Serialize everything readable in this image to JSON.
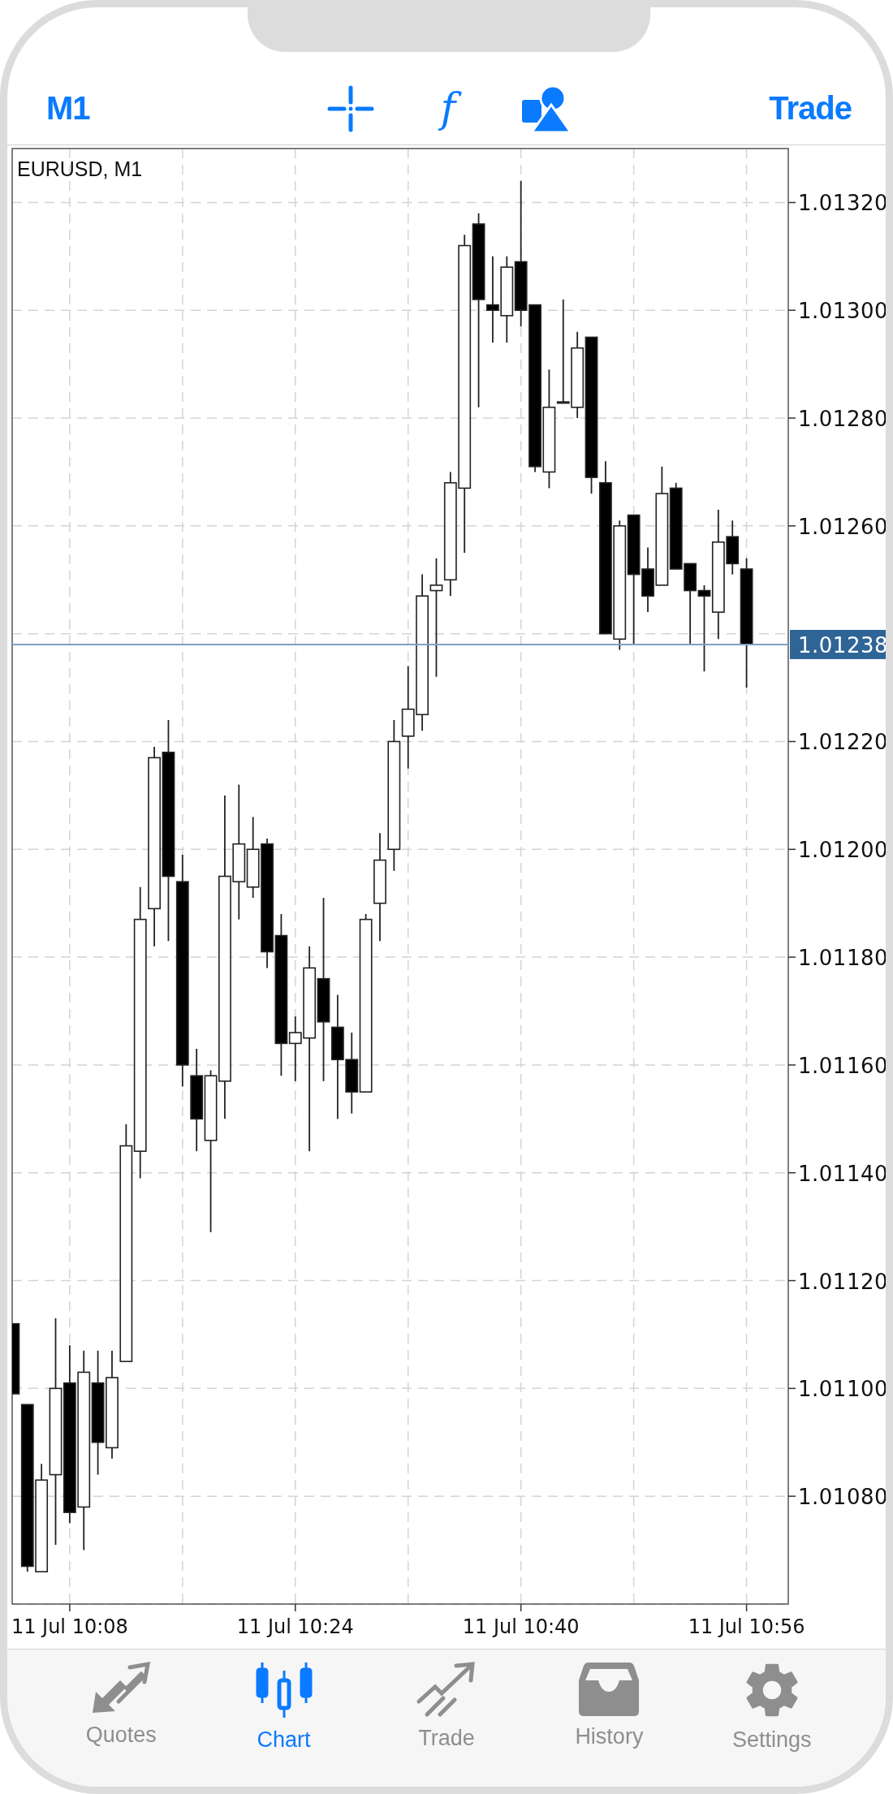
{
  "top_bar": {
    "timeframe": "M1",
    "tools": [
      {
        "kind": "crosshair"
      },
      {
        "kind": "text",
        "label": "f"
      },
      {
        "kind": "shapes"
      }
    ],
    "trade": "Trade"
  },
  "chart": {
    "symbol_label": "EURUSD, M1",
    "chart_data": {
      "type": "candlestick",
      "grid": true,
      "ylim": [
        1.0106,
        1.0133
      ],
      "ref_lines": [
        {
          "axis": "y",
          "value": 1.01238,
          "label": "1.01238",
          "color": "#7fa1c1"
        }
      ],
      "categories": [
        null,
        null,
        null,
        null,
        "11 Jul 10:08",
        null,
        null,
        null,
        null,
        null,
        null,
        null,
        null,
        null,
        null,
        null,
        null,
        null,
        null,
        null,
        "11 Jul 10:24",
        null,
        null,
        null,
        null,
        null,
        null,
        null,
        null,
        null,
        null,
        null,
        null,
        null,
        null,
        null,
        "11 Jul 10:40",
        null,
        null,
        null,
        null,
        null,
        null,
        null,
        null,
        null,
        null,
        null,
        null,
        null,
        null,
        null,
        "11 Jul 10:56"
      ],
      "ohlc": [
        [
          1.01112,
          1.01112,
          1.01099,
          1.01099
        ],
        [
          1.01097,
          1.01097,
          1.01066,
          1.01067
        ],
        [
          1.01066,
          1.01086,
          1.01066,
          1.01083
        ],
        [
          1.01084,
          1.01113,
          1.01071,
          1.011
        ],
        [
          1.01101,
          1.01108,
          1.01075,
          1.01077
        ],
        [
          1.01078,
          1.01107,
          1.0107,
          1.01103
        ],
        [
          1.01101,
          1.01107,
          1.01084,
          1.0109
        ],
        [
          1.01089,
          1.01107,
          1.01087,
          1.01102
        ],
        [
          1.01105,
          1.01149,
          1.01105,
          1.01145
        ],
        [
          1.01144,
          1.01193,
          1.01139,
          1.01187
        ],
        [
          1.01189,
          1.01219,
          1.01182,
          1.01217
        ],
        [
          1.01218,
          1.01224,
          1.01183,
          1.01195
        ],
        [
          1.01194,
          1.01199,
          1.01156,
          1.0116
        ],
        [
          1.01158,
          1.01163,
          1.01144,
          1.0115
        ],
        [
          1.01146,
          1.01159,
          1.01129,
          1.01158
        ],
        [
          1.01157,
          1.0121,
          1.0115,
          1.01195
        ],
        [
          1.01194,
          1.01212,
          1.01187,
          1.01201
        ],
        [
          1.01193,
          1.01206,
          1.01191,
          1.012
        ],
        [
          1.01201,
          1.01202,
          1.01178,
          1.01181
        ],
        [
          1.01184,
          1.01188,
          1.01158,
          1.01164
        ],
        [
          1.01164,
          1.01169,
          1.01157,
          1.01166
        ],
        [
          1.01165,
          1.01182,
          1.01144,
          1.01178
        ],
        [
          1.01176,
          1.01191,
          1.01157,
          1.01168
        ],
        [
          1.01167,
          1.01173,
          1.0115,
          1.01161
        ],
        [
          1.01161,
          1.01166,
          1.01151,
          1.01155
        ],
        [
          1.01155,
          1.01188,
          1.01155,
          1.01187
        ],
        [
          1.0119,
          1.01203,
          1.01183,
          1.01198
        ],
        [
          1.012,
          1.01224,
          1.01196,
          1.0122
        ],
        [
          1.01221,
          1.01234,
          1.01215,
          1.01226
        ],
        [
          1.01225,
          1.01251,
          1.01222,
          1.01247
        ],
        [
          1.01248,
          1.01254,
          1.01232,
          1.01249
        ],
        [
          1.0125,
          1.0127,
          1.01247,
          1.01268
        ],
        [
          1.01267,
          1.01314,
          1.01255,
          1.01312
        ],
        [
          1.01316,
          1.01318,
          1.01282,
          1.01302
        ],
        [
          1.01301,
          1.0131,
          1.01294,
          1.013
        ],
        [
          1.01299,
          1.0131,
          1.01294,
          1.01308
        ],
        [
          1.01309,
          1.01324,
          1.01297,
          1.013
        ],
        [
          1.01301,
          1.01301,
          1.0127,
          1.01271
        ],
        [
          1.0127,
          1.01289,
          1.01267,
          1.01282
        ],
        [
          1.01283,
          1.01302,
          1.01283,
          1.01283
        ],
        [
          1.01282,
          1.01296,
          1.0128,
          1.01293
        ],
        [
          1.01295,
          1.01295,
          1.01266,
          1.01269
        ],
        [
          1.01268,
          1.01272,
          1.0124,
          1.0124
        ],
        [
          1.01239,
          1.01261,
          1.01237,
          1.0126
        ],
        [
          1.01262,
          1.01262,
          1.01238,
          1.01251
        ],
        [
          1.01252,
          1.01256,
          1.01244,
          1.01247
        ],
        [
          1.01249,
          1.01271,
          1.01249,
          1.01266
        ],
        [
          1.01267,
          1.01268,
          1.01252,
          1.01252
        ],
        [
          1.01253,
          1.01253,
          1.01238,
          1.01248
        ],
        [
          1.01248,
          1.01249,
          1.01233,
          1.01247
        ],
        [
          1.01244,
          1.01263,
          1.01239,
          1.01257
        ],
        [
          1.01258,
          1.01261,
          1.01251,
          1.01253
        ],
        [
          1.01252,
          1.01254,
          1.0123,
          1.01238
        ]
      ],
      "yticks": [
        {
          "value": 1.0108,
          "label": "1.01080"
        },
        {
          "value": 1.011,
          "label": "1.01100"
        },
        {
          "value": 1.0112,
          "label": "1.01120"
        },
        {
          "value": 1.0114,
          "label": "1.01140"
        },
        {
          "value": 1.0116,
          "label": "1.01160"
        },
        {
          "value": 1.0118,
          "label": "1.01180"
        },
        {
          "value": 1.012,
          "label": "1.01200"
        },
        {
          "value": 1.0122,
          "label": "1.01220"
        },
        {
          "value": 1.0126,
          "label": "1.01260"
        },
        {
          "value": 1.0128,
          "label": "1.01280"
        },
        {
          "value": 1.013,
          "label": "1.01300"
        },
        {
          "value": 1.0132,
          "label": "1.01320"
        }
      ]
    }
  },
  "tab_bar": [
    {
      "kind": "quotes",
      "label": "Quotes",
      "selected": false
    },
    {
      "kind": "chart",
      "label": "Chart",
      "selected": true
    },
    {
      "kind": "trade",
      "label": "Trade",
      "selected": false
    },
    {
      "kind": "history",
      "label": "History",
      "selected": false
    },
    {
      "kind": "settings",
      "label": "Settings",
      "selected": false
    }
  ]
}
